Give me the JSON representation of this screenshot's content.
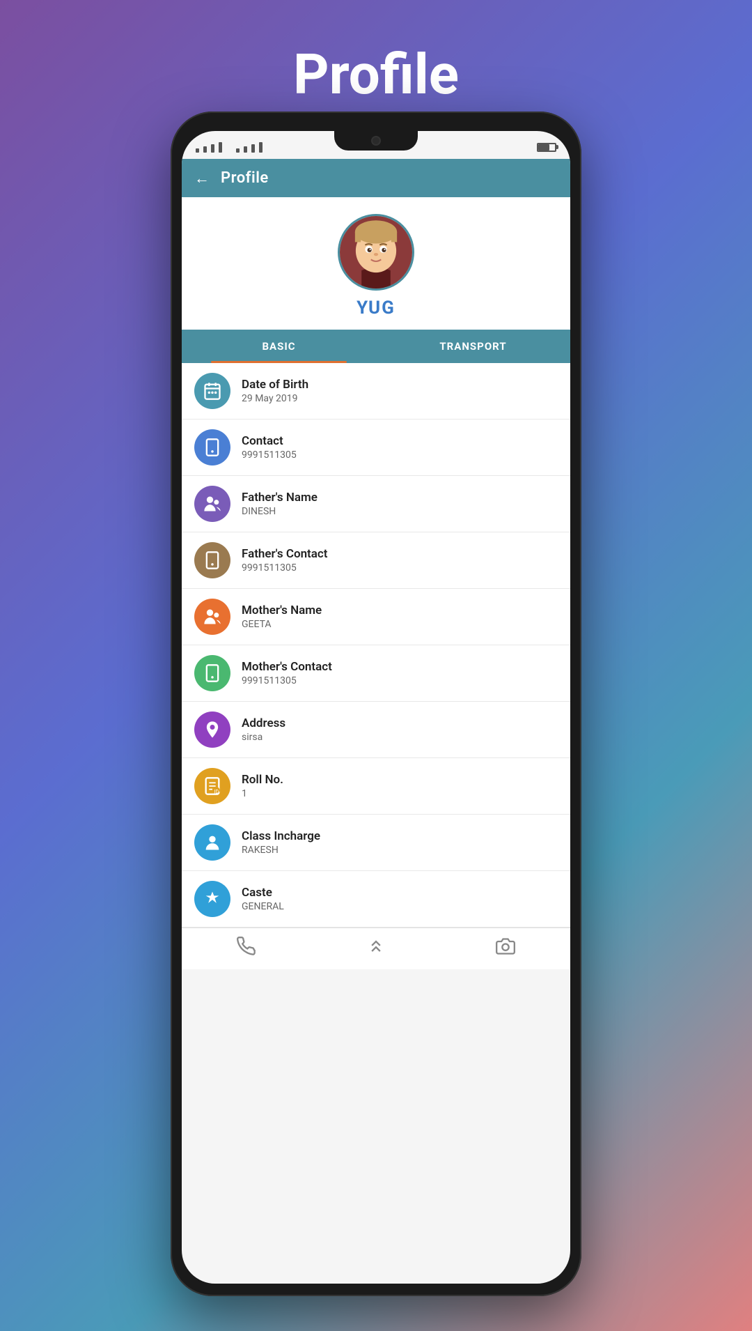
{
  "pageTitle": "Profile",
  "student": {
    "name": "YUG",
    "avatarAlt": "student photo"
  },
  "header": {
    "title": "Profile",
    "backLabel": "←"
  },
  "tabs": [
    {
      "id": "basic",
      "label": "BASIC",
      "active": true
    },
    {
      "id": "transport",
      "label": "TRANSPORT",
      "active": false
    }
  ],
  "infoItems": [
    {
      "id": "dob",
      "label": "Date of Birth",
      "value": "29 May 2019",
      "iconColor": "icon-teal",
      "iconSymbol": "📅"
    },
    {
      "id": "contact",
      "label": "Contact",
      "value": "9991511305",
      "iconColor": "icon-blue",
      "iconSymbol": "☎"
    },
    {
      "id": "father-name",
      "label": "Father's Name",
      "value": "DINESH",
      "iconColor": "icon-purple",
      "iconSymbol": "👨‍👧"
    },
    {
      "id": "father-contact",
      "label": "Father's Contact",
      "value": "9991511305",
      "iconColor": "icon-brown",
      "iconSymbol": "☎"
    },
    {
      "id": "mother-name",
      "label": "Mother's Name",
      "value": "GEETA",
      "iconColor": "icon-orange",
      "iconSymbol": "👩‍👧"
    },
    {
      "id": "mother-contact",
      "label": "Mother's Contact",
      "value": "9991511305",
      "iconColor": "icon-green",
      "iconSymbol": "☎"
    },
    {
      "id": "address",
      "label": "Address",
      "value": "sirsa",
      "iconColor": "icon-violet",
      "iconSymbol": "🏠"
    },
    {
      "id": "roll-no",
      "label": "Roll No.",
      "value": "1",
      "iconColor": "icon-yellow",
      "iconSymbol": "📋"
    },
    {
      "id": "class-incharge",
      "label": "Class Incharge",
      "value": "RAKESH",
      "iconColor": "icon-sky",
      "iconSymbol": "👤"
    },
    {
      "id": "caste",
      "label": "Caste",
      "value": "GENERAL",
      "iconColor": "icon-sky",
      "iconSymbol": "🎓"
    }
  ],
  "bottomNav": {
    "phone": "📞",
    "home": "⌃⌃",
    "camera": "📷"
  }
}
